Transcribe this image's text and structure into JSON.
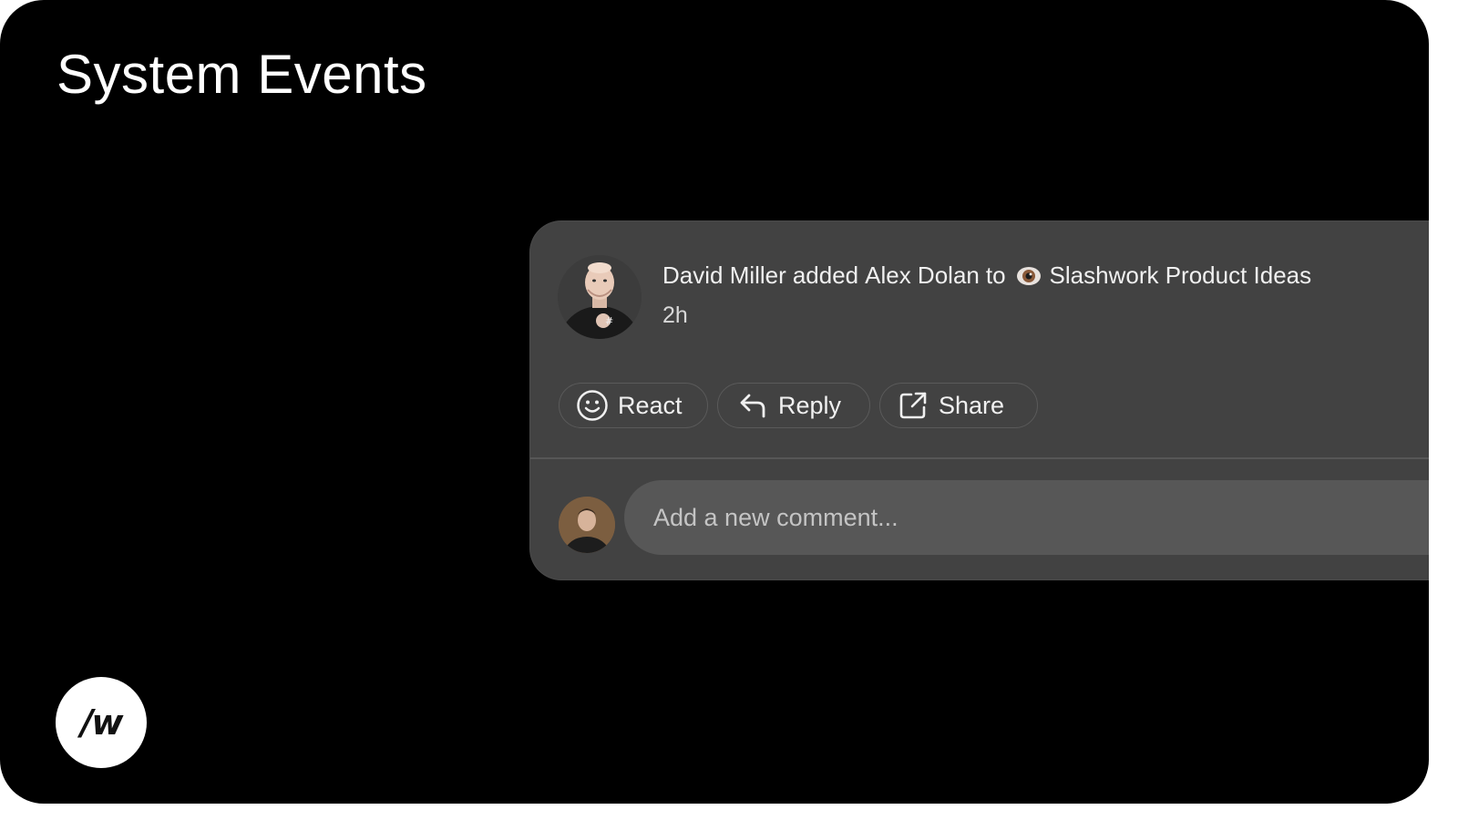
{
  "slide": {
    "title": "System Events"
  },
  "event": {
    "actor_name": "David Miller",
    "action": "added",
    "target_name": "Alex Dolan",
    "preposition": "to",
    "channel_icon": "eye-icon",
    "channel_name": "Slashwork Product Ideas",
    "time": "2h"
  },
  "actions": {
    "react_label": "React",
    "reply_label": "Reply",
    "share_label": "Share"
  },
  "comment": {
    "placeholder": "Add a new comment..."
  },
  "brand": {
    "logo_text": "/w"
  },
  "colors": {
    "background": "#000000",
    "card": "#424242",
    "input": "#575757",
    "text": "#f0f0f0"
  }
}
